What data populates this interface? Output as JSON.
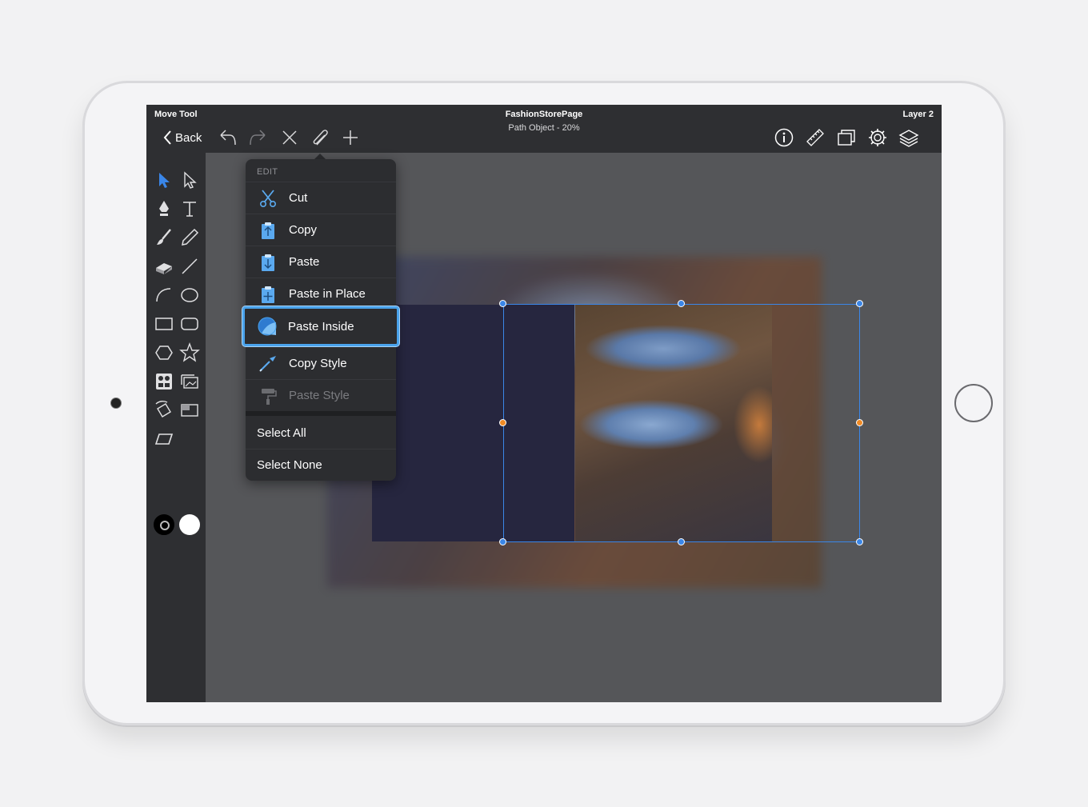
{
  "header": {
    "tool_name": "Move Tool",
    "document_title": "FashionStorePage",
    "document_subtitle": "Path Object - 20%",
    "layer_name": "Layer 2",
    "back_label": "Back"
  },
  "toolbar_icons": [
    "undo-icon",
    "redo-icon",
    "close-icon",
    "paperclip-icon",
    "plus-icon",
    "info-icon",
    "ruler-icon",
    "window-icon",
    "gear-icon",
    "layers-icon"
  ],
  "sidebar_tools": [
    "move-tool",
    "direct-select-tool",
    "pen-tool",
    "text-tool",
    "brush-tool",
    "pencil-tool",
    "eraser-tool",
    "line-tool",
    "arc-tool",
    "ellipse-tool",
    "rectangle-tool",
    "rounded-rectangle-tool",
    "hexagon-tool",
    "star-tool",
    "image-grid-tool",
    "gallery-tool",
    "transform-tool",
    "frame-tool",
    "skew-tool"
  ],
  "colors": {
    "stroke": "#000000",
    "fill": "#ffffff",
    "accent": "#3a86e8",
    "handle_mid": "#f08a24"
  },
  "edit_menu": {
    "header": "EDIT",
    "items": [
      {
        "label": "Cut",
        "icon": "scissors-icon"
      },
      {
        "label": "Copy",
        "icon": "clipboard-copy-icon"
      },
      {
        "label": "Paste",
        "icon": "clipboard-paste-icon"
      },
      {
        "label": "Paste in Place",
        "icon": "clipboard-plus-icon"
      },
      {
        "label": "Paste Inside",
        "icon": "paste-inside-icon",
        "highlighted": true
      },
      {
        "label": "Copy Style",
        "icon": "eyedropper-icon"
      },
      {
        "label": "Paste Style",
        "icon": "paint-roller-icon",
        "disabled": true
      }
    ],
    "select_all": "Select All",
    "select_none": "Select None"
  }
}
